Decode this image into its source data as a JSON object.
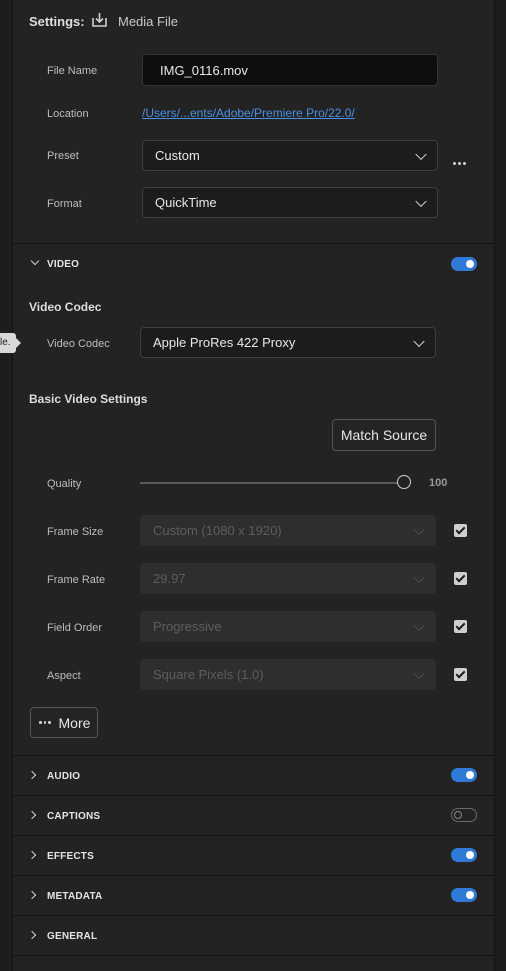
{
  "settings": {
    "label": "Settings:",
    "destination_icon": "download-icon",
    "destination": "Media File"
  },
  "file_name": {
    "label": "File Name",
    "value": "IMG_0116.mov"
  },
  "location": {
    "label": "Location",
    "value": "/Users/...ents/Adobe/Premiere Pro/22.0/"
  },
  "preset": {
    "label": "Preset",
    "value": "Custom",
    "more_icon": "more-icon"
  },
  "format": {
    "label": "Format",
    "value": "QuickTime"
  },
  "video": {
    "title": "VIDEO",
    "enabled": true,
    "codec_heading": "Video Codec",
    "codec_label": "Video Codec",
    "codec_value": "Apple ProRes 422 Proxy",
    "tooltip_fragment": "le.",
    "basic_heading": "Basic Video Settings",
    "match_source": "Match Source",
    "quality": {
      "label": "Quality",
      "value": "100",
      "fraction": 1.0
    },
    "frame_size": {
      "label": "Frame Size",
      "value": "Custom (1080 x 1920)",
      "checked": true
    },
    "frame_rate": {
      "label": "Frame Rate",
      "value": "29.97",
      "checked": true
    },
    "field_order": {
      "label": "Field Order",
      "value": "Progressive",
      "checked": true
    },
    "aspect": {
      "label": "Aspect",
      "value": "Square Pixels (1.0)",
      "checked": true
    },
    "more": "More"
  },
  "sections": [
    {
      "title": "AUDIO",
      "enabled": true
    },
    {
      "title": "CAPTIONS",
      "enabled": false
    },
    {
      "title": "EFFECTS",
      "enabled": true
    },
    {
      "title": "METADATA",
      "enabled": true
    },
    {
      "title": "GENERAL"
    }
  ],
  "colors": {
    "accent": "#2e7ad6",
    "link": "#4a90e2",
    "panel": "#232323"
  }
}
